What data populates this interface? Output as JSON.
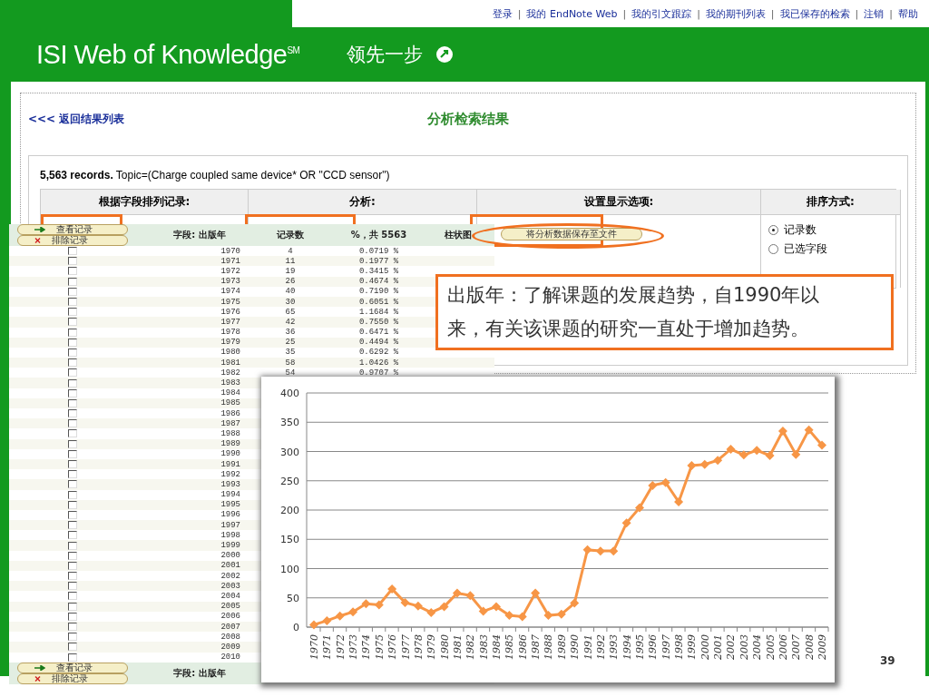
{
  "top_links": [
    {
      "kind": "link",
      "label": "登录"
    },
    {
      "kind": "separator",
      "label": "|"
    },
    {
      "kind": "link",
      "label": "我的 EndNote Web"
    },
    {
      "kind": "separator",
      "label": "|"
    },
    {
      "kind": "link",
      "label": "我的引文跟踪"
    },
    {
      "kind": "separator",
      "label": "|"
    },
    {
      "kind": "link",
      "label": "我的期刊列表"
    },
    {
      "kind": "separator",
      "label": "|"
    },
    {
      "kind": "link",
      "label": "我已保存的检索"
    },
    {
      "kind": "separator",
      "label": "|"
    },
    {
      "kind": "link",
      "label": "注销"
    },
    {
      "kind": "separator",
      "label": "|"
    },
    {
      "kind": "link",
      "label": "帮助"
    }
  ],
  "header": {
    "logo": "ISI Web of Knowledge",
    "logo_mark": "SM",
    "slogan": "领先一步"
  },
  "page": {
    "back_link": "<<< 返回结果列表",
    "title": "分析检索结果",
    "summary": "**5,563 records.** Topic=(Charge coupled same device* OR \"CCD sensor\")",
    "columns": [
      "根据字段排列记录:",
      "分析:",
      "设置显示选项:",
      "排序方式:"
    ],
    "sort_options": [
      {
        "label": "记录数",
        "selected": true
      },
      {
        "label": "已选字段",
        "selected": false
      }
    ]
  },
  "results_table": {
    "buttons": [
      {
        "label": "查看记录",
        "kind": "view"
      },
      {
        "label": "排除记录",
        "kind": "exclude"
      }
    ],
    "columns": [
      "字段: 出版年",
      "记录数",
      "%，共 5563",
      "柱状图"
    ],
    "save_button": "将分析数据保存至文件",
    "rows": [
      {
        "year": "1970",
        "count": "4",
        "percent": "0.0719 %",
        "checked": false
      },
      {
        "year": "1971",
        "count": "11",
        "percent": "0.1977 %",
        "checked": false
      },
      {
        "year": "1972",
        "count": "19",
        "percent": "0.3415 %",
        "checked": false
      },
      {
        "year": "1973",
        "count": "26",
        "percent": "0.4674 %",
        "checked": false
      },
      {
        "year": "1974",
        "count": "40",
        "percent": "0.7190 %",
        "checked": false
      },
      {
        "year": "1975",
        "count": "30",
        "percent": "0.6051 %",
        "checked": false
      },
      {
        "year": "1976",
        "count": "65",
        "percent": "1.1684 %",
        "checked": false
      },
      {
        "year": "1977",
        "count": "42",
        "percent": "0.7550 %",
        "checked": false
      },
      {
        "year": "1978",
        "count": "36",
        "percent": "0.6471 %",
        "checked": false
      },
      {
        "year": "1979",
        "count": "25",
        "percent": "0.4494 %",
        "checked": false
      },
      {
        "year": "1980",
        "count": "35",
        "percent": "0.6292 %",
        "checked": false
      },
      {
        "year": "1981",
        "count": "58",
        "percent": "1.0426 %",
        "checked": false
      },
      {
        "year": "1982",
        "count": "54",
        "percent": "0.9707 %",
        "checked": false
      },
      {
        "year": "1983",
        "checked": false
      },
      {
        "year": "1984",
        "checked": false
      },
      {
        "year": "1985",
        "checked": false
      },
      {
        "year": "1986",
        "checked": false
      },
      {
        "year": "1987",
        "checked": false
      },
      {
        "year": "1988",
        "checked": false
      },
      {
        "year": "1989",
        "checked": false
      },
      {
        "year": "1990",
        "checked": false
      },
      {
        "year": "1991",
        "checked": false
      },
      {
        "year": "1992",
        "checked": false
      },
      {
        "year": "1993",
        "checked": false
      },
      {
        "year": "1994",
        "checked": false
      },
      {
        "year": "1995",
        "checked": false
      },
      {
        "year": "1996",
        "checked": false
      },
      {
        "year": "1997",
        "checked": false
      },
      {
        "year": "1998",
        "checked": false
      },
      {
        "year": "1999",
        "checked": false
      },
      {
        "year": "2000",
        "checked": false
      },
      {
        "year": "2001",
        "checked": false
      },
      {
        "year": "2002",
        "checked": false
      },
      {
        "year": "2003",
        "checked": false
      },
      {
        "year": "2004",
        "checked": false
      },
      {
        "year": "2005",
        "checked": false
      },
      {
        "year": "2006",
        "checked": false
      },
      {
        "year": "2007",
        "checked": false
      },
      {
        "year": "2008",
        "checked": false
      },
      {
        "year": "2009",
        "checked": false
      },
      {
        "year": "2010",
        "checked": false
      }
    ],
    "footer": {
      "buttons": [
        {
          "label": "查看记录",
          "kind": "view"
        },
        {
          "label": "排除记录",
          "kind": "exclude"
        }
      ],
      "field_label": "字段: 出版年"
    }
  },
  "callout": "出版年：了解课题的发展趋势，自1990年以来，有关该课题的研究一直处于增加趋势。",
  "chart": {
    "chart_data": {
      "type": "line",
      "categories": [
        "1970",
        "1971",
        "1972",
        "1973",
        "1974",
        "1975",
        "1976",
        "1977",
        "1978",
        "1979",
        "1980",
        "1981",
        "1982",
        "1983",
        "1984",
        "1985",
        "1986",
        "1987",
        "1988",
        "1989",
        "1990",
        "1991",
        "1992",
        "1993",
        "1994",
        "1995",
        "1996",
        "1997",
        "1998",
        "1999",
        "2000",
        "2001",
        "2002",
        "2003",
        "2004",
        "2005",
        "2006",
        "2007",
        "2008",
        "2009"
      ],
      "series": [
        {
          "color": "#f79646",
          "marker": "diamond",
          "values": [
            4,
            11,
            19,
            26,
            40,
            38,
            65,
            42,
            36,
            25,
            35,
            58,
            54,
            27,
            35,
            20,
            18,
            58,
            20,
            22,
            41,
            132,
            130,
            130,
            178,
            204,
            242,
            247,
            214,
            276,
            278,
            285,
            304,
            294,
            302,
            293,
            335,
            295,
            337,
            311
          ]
        }
      ],
      "grid": true,
      "ylim": [
        0,
        400
      ],
      "yticks": [
        0,
        50,
        100,
        150,
        200,
        250,
        300,
        350,
        400
      ]
    }
  },
  "page_number": "39"
}
